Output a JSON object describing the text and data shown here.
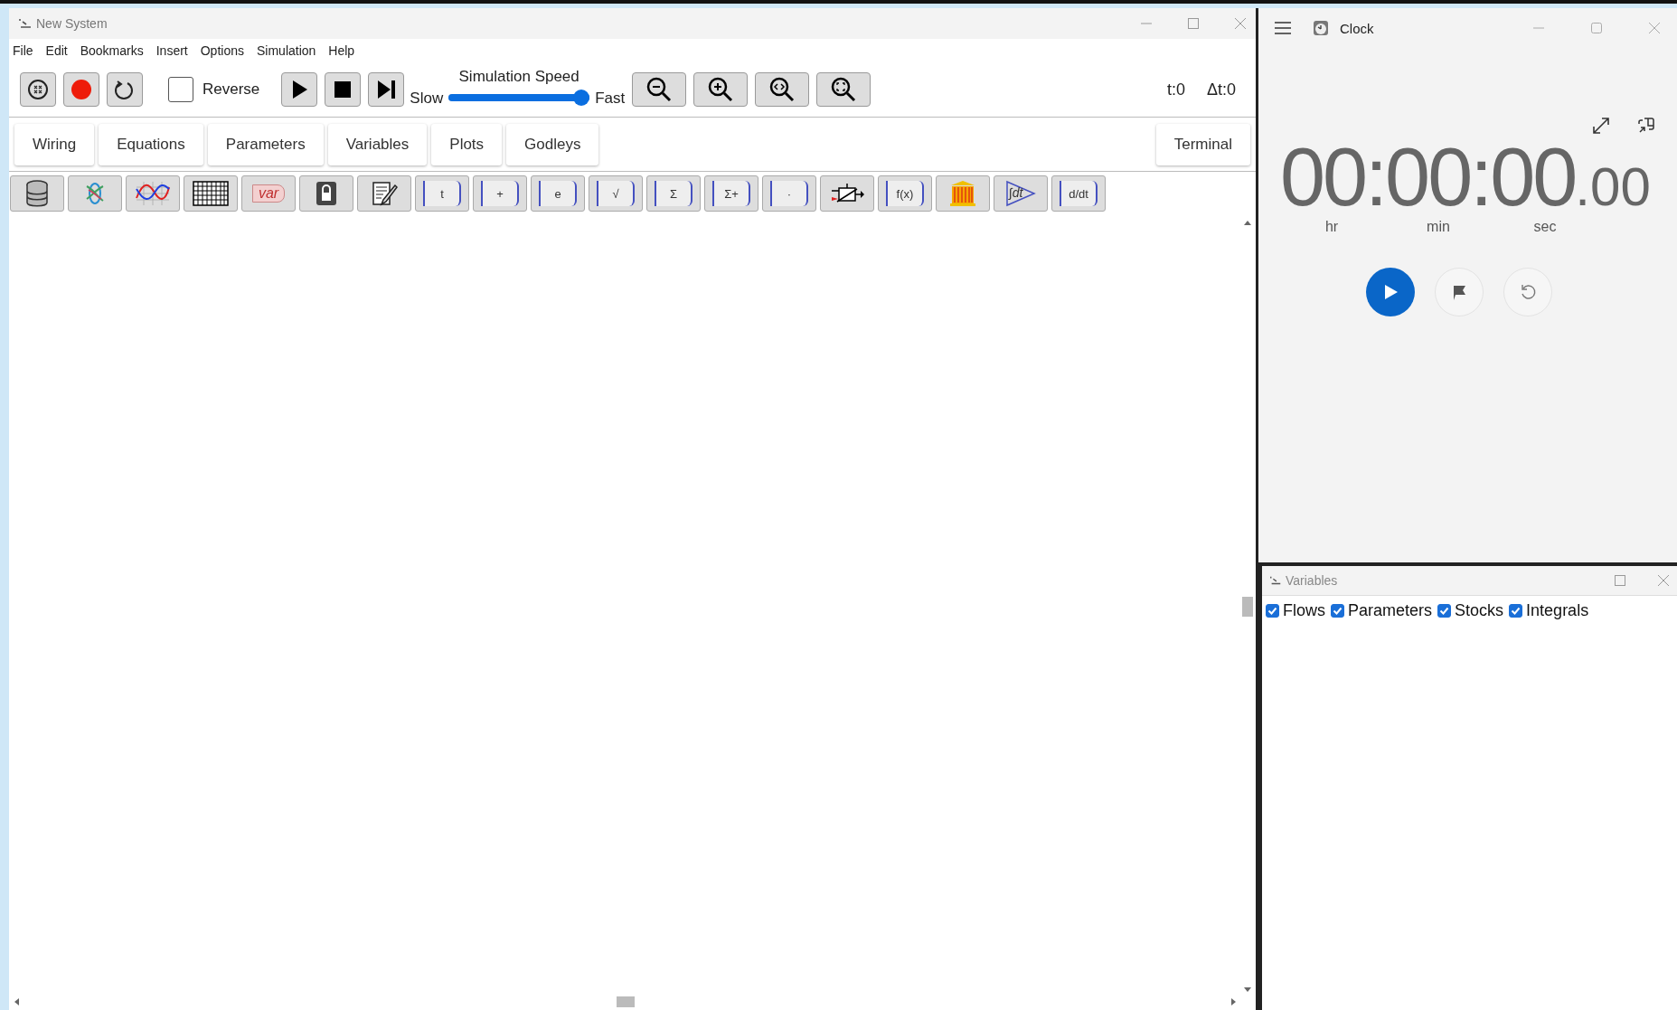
{
  "main_window": {
    "title": "New System",
    "menu": [
      "File",
      "Edit",
      "Bookmarks",
      "Insert",
      "Options",
      "Simulation",
      "Help"
    ],
    "reverse": {
      "label": "Reverse",
      "checked": false
    },
    "speed": {
      "title": "Simulation Speed",
      "min_label": "Slow",
      "max_label": "Fast",
      "level": 1.0
    },
    "time": "t:0",
    "delta_time": "Δt:0",
    "tabs": [
      {
        "label": "Wiring",
        "selected": false
      },
      {
        "label": "Equations",
        "selected": false
      },
      {
        "label": "Parameters",
        "selected": false
      },
      {
        "label": "Variables",
        "selected": false
      },
      {
        "label": "Plots",
        "selected": false
      },
      {
        "label": "Godleys",
        "selected": false
      }
    ],
    "terminal_tab": {
      "label": "Terminal",
      "selected": false
    },
    "palette": [
      {
        "kind": "database"
      },
      {
        "kind": "sphere"
      },
      {
        "kind": "plot"
      },
      {
        "kind": "grid"
      },
      {
        "kind": "var",
        "label": "var"
      },
      {
        "kind": "lock"
      },
      {
        "kind": "note"
      },
      {
        "kind": "operator",
        "label": "t"
      },
      {
        "kind": "operator",
        "label": "+"
      },
      {
        "kind": "operator",
        "label": "e"
      },
      {
        "kind": "operator",
        "label": "√"
      },
      {
        "kind": "operator",
        "label": "Σ"
      },
      {
        "kind": "operator",
        "label": "Σ+"
      },
      {
        "kind": "operator",
        "label": "·"
      },
      {
        "kind": "switch"
      },
      {
        "kind": "operator",
        "label": "f(x)"
      },
      {
        "kind": "godley"
      },
      {
        "kind": "integral",
        "label": "∫dt"
      },
      {
        "kind": "operator",
        "label": "d/dt"
      }
    ]
  },
  "clock_window": {
    "title": "Clock",
    "time": "00:00:00",
    "fraction": ".00",
    "units": [
      "hr",
      "min",
      "sec"
    ]
  },
  "variables_window": {
    "title": "Variables",
    "filters": [
      {
        "label": "Flows",
        "checked": true
      },
      {
        "label": "Parameters",
        "checked": true
      },
      {
        "label": "Stocks",
        "checked": true
      },
      {
        "label": "Integrals",
        "checked": true
      }
    ]
  }
}
